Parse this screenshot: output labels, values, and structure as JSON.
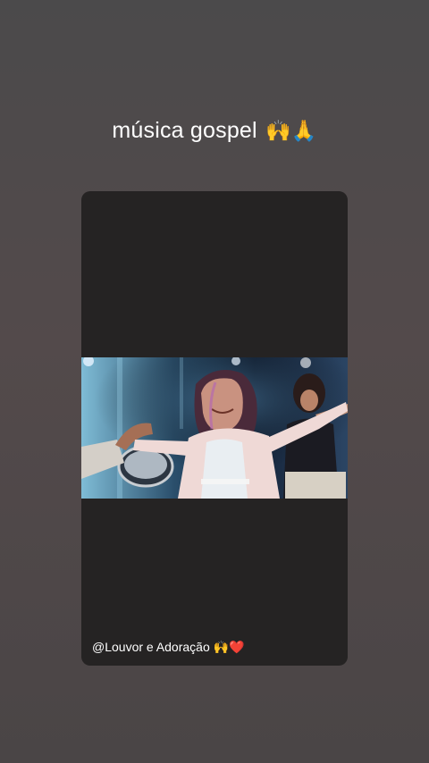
{
  "story": {
    "caption_text": "música gospel",
    "caption_emoji": "🙌🙏"
  },
  "card": {
    "mention_text": "@Louvor e Adoração",
    "mention_emoji": "🙌❤️"
  },
  "video": {
    "description_icon": "video-frame-worship-singer"
  }
}
